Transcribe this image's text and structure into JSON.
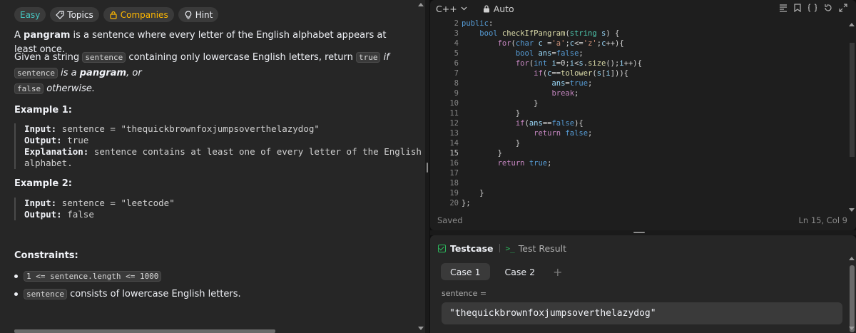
{
  "tags": {
    "difficulty": "Easy",
    "topics": "Topics",
    "companies": "Companies",
    "hint": "Hint"
  },
  "description": {
    "p1_a": "A ",
    "p1_bold": "pangram",
    "p1_b": " is a sentence where every letter of the English alphabet appears at least once.",
    "p2_a": "Given a string ",
    "p2_code1": "sentence",
    "p2_b": " containing only lowercase English letters, return ",
    "p2_code2": "true",
    "p2_c": " if ",
    "p2_code3": "sentence",
    "p2_d": " is a ",
    "p2_bold": "pangram",
    "p2_e": ", or",
    "p2_code4": "false",
    "p2_f": " otherwise."
  },
  "examples": [
    {
      "title": "Example 1:",
      "input_label": "Input:",
      "input_value": " sentence = \"thequickbrownfoxjumpsoverthelazydog\"",
      "output_label": "Output:",
      "output_value": " true",
      "explanation_label": "Explanation:",
      "explanation_value": " sentence contains at least one of every letter of the English",
      "explanation_value2": "alphabet."
    },
    {
      "title": "Example 2:",
      "input_label": "Input:",
      "input_value": " sentence = \"leetcode\"",
      "output_label": "Output:",
      "output_value": " false"
    }
  ],
  "constraints": {
    "title": "Constraints:",
    "c1_code": "1 <= sentence.length <= 1000",
    "c2_code": "sentence",
    "c2_text": " consists of lowercase English letters."
  },
  "editor": {
    "language": "C++",
    "mode": "Auto",
    "status": "Saved",
    "cursor": "Ln 15, Col 9",
    "current_line": 15,
    "line_numbers": [
      "2",
      "3",
      "4",
      "5",
      "6",
      "7",
      "8",
      "9",
      "10",
      "11",
      "12",
      "13",
      "14",
      "15",
      "16",
      "17",
      "18",
      "19",
      "20"
    ],
    "code_lines": [
      "public:",
      "    bool checkIfPangram(string s) {",
      "        for(char c ='a';c<='z';c++){",
      "            bool ans=false;",
      "            for(int i=0;i<s.size();i++){",
      "                if(c==tolower(s[i])){",
      "                    ans=true;",
      "                    break;",
      "                }",
      "            }",
      "            if(ans==false){",
      "                return false;",
      "            }",
      "        }",
      "        return true;",
      "",
      "",
      "    }",
      "};"
    ]
  },
  "testcase": {
    "tab_label": "Testcase",
    "result_label": "Test Result",
    "result_prompt": ">_",
    "cases": [
      "Case 1",
      "Case 2"
    ],
    "add": "+",
    "field_label": "sentence =",
    "field_value": "\"thequickbrownfoxjumpsoverthelazydog\""
  }
}
